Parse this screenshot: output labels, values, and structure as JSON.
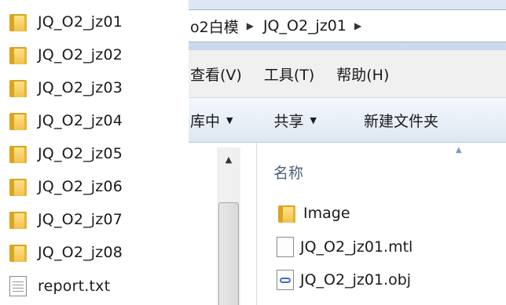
{
  "left_list": {
    "items": [
      {
        "label": "JQ_O2_jz01",
        "icon": "folder-icon"
      },
      {
        "label": "JQ_O2_jz02",
        "icon": "folder-icon"
      },
      {
        "label": "JQ_O2_jz03",
        "icon": "folder-icon"
      },
      {
        "label": "JQ_O2_jz04",
        "icon": "folder-icon"
      },
      {
        "label": "JQ_O2_jz05",
        "icon": "folder-icon"
      },
      {
        "label": "JQ_O2_jz06",
        "icon": "folder-icon"
      },
      {
        "label": "JQ_O2_jz07",
        "icon": "folder-icon"
      },
      {
        "label": "JQ_O2_jz08",
        "icon": "folder-icon"
      },
      {
        "label": "report.txt",
        "icon": "text-file-icon"
      }
    ]
  },
  "explorer": {
    "breadcrumb": {
      "segment1": "o2白模",
      "segment2": "JQ_O2_jz01",
      "separator": "▶"
    },
    "menu": {
      "view": "查看(V)",
      "tools": "工具(T)",
      "help": "帮助(H)"
    },
    "toolbar": {
      "library": "库中",
      "share": "共享",
      "new_folder": "新建文件夹",
      "caret": "▼"
    },
    "column_header": {
      "name": "名称",
      "sort_indicator": "▲"
    },
    "files": [
      {
        "name": "Image",
        "icon": "folder-icon"
      },
      {
        "name": "JQ_O2_jz01.mtl",
        "icon": "file-icon"
      },
      {
        "name": "JQ_O2_jz01.obj",
        "icon": "obj-file-icon"
      }
    ]
  },
  "colors": {
    "folder": "#f2c14a",
    "address_bar": "#c9d9ec",
    "column_header_text": "#4c607a"
  }
}
